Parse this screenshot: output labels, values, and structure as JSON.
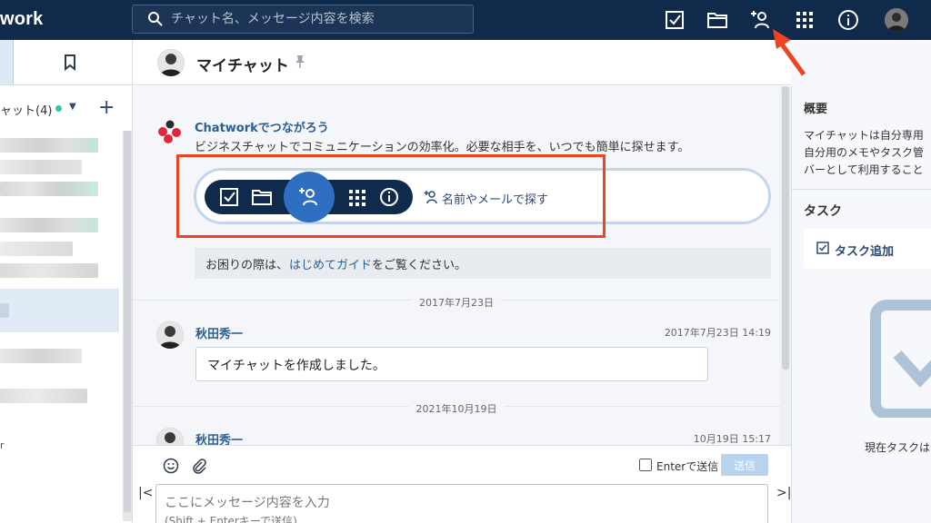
{
  "app": {
    "logo_text": "work"
  },
  "search": {
    "placeholder": "チャット名、メッセージ内容を検索"
  },
  "topbar_icons": [
    "task-icon",
    "folder-icon",
    "add-contact-icon",
    "apps-grid-icon",
    "info-icon",
    "user-avatar"
  ],
  "sidebar": {
    "header_label": "ャット(4)",
    "footer_fragment": "r"
  },
  "room": {
    "title": "マイチャット"
  },
  "welcome": {
    "title": "Chatworkでつながろう",
    "description": "ビジネスチャットでコミュニケーションの効率化。必要な相手を、いつでも簡単に探せます。",
    "find_link": "名前やメールで探す"
  },
  "guide": {
    "prefix": "お困りの際は、",
    "link": "はじめてガイド",
    "suffix": "をご覧ください。"
  },
  "timeline": {
    "date_separators": [
      "2017年7月23日",
      "2021年10月19日"
    ],
    "messages": [
      {
        "author": "秋田秀一",
        "timestamp": "2017年7月23日 14:19",
        "body": "マイチャットを作成しました。"
      },
      {
        "author": "秋田秀一",
        "timestamp": "10月19日 15:17",
        "body": ""
      }
    ]
  },
  "composer": {
    "enter_to_send_label": "Enterで送信",
    "enter_to_send_checked": false,
    "send_label": "送信",
    "placeholder_line1": "ここにメッセージ内容を入力",
    "placeholder_line2": "(Shift + Enterキーで送信)"
  },
  "right_panel": {
    "overview_title": "概要",
    "overview_lines": [
      "マイチャットは自分専用",
      "自分用のメモやタスク管",
      "バーとして利用すること"
    ],
    "task_title": "タスク",
    "task_add_label": "タスク追加",
    "no_task_text": "現在タスクは"
  },
  "colors": {
    "topbar": "#0f2a4a",
    "accent": "#2f6fc1",
    "highlight_annotation": "#ee4422"
  }
}
